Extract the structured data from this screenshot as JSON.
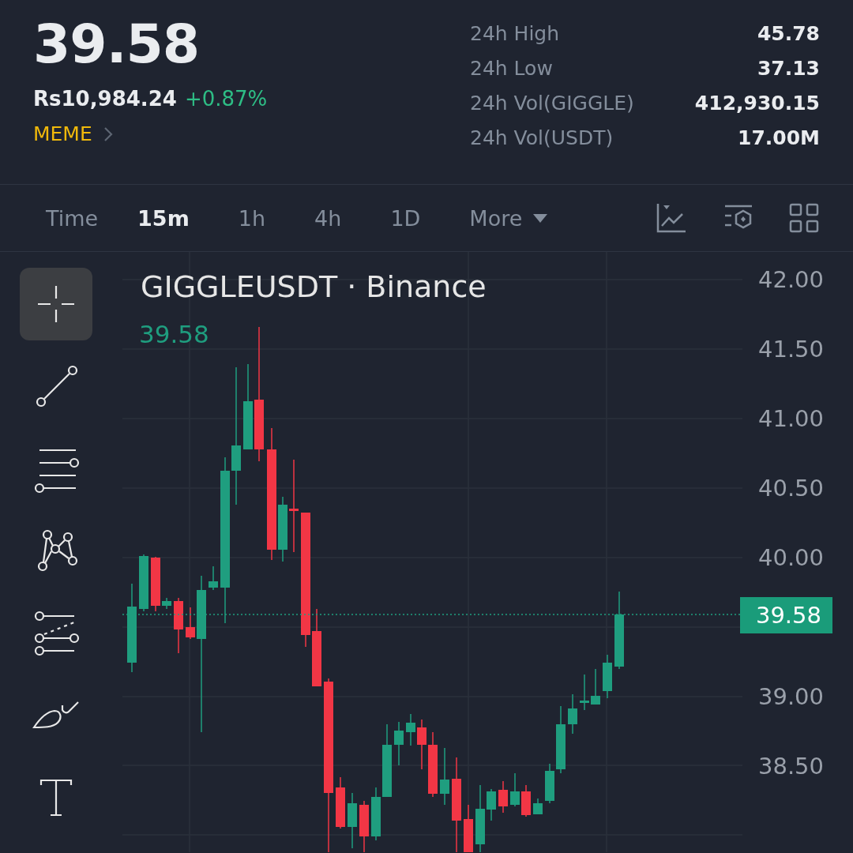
{
  "ticker": {
    "price": "39.58",
    "fiat_price": "Rs10,984.24",
    "change": "+0.87%",
    "tag": "MEME"
  },
  "stats": [
    {
      "label": "24h High",
      "value": "45.78"
    },
    {
      "label": "24h Low",
      "value": "37.13"
    },
    {
      "label": "24h Vol(GIGGLE)",
      "value": "412,930.15"
    },
    {
      "label": "24h Vol(USDT)",
      "value": "17.00M"
    }
  ],
  "interval_bar": {
    "label": "Time",
    "intervals": [
      {
        "label": "15m",
        "selected": true
      },
      {
        "label": "1h",
        "selected": false
      },
      {
        "label": "4h",
        "selected": false
      },
      {
        "label": "1D",
        "selected": false
      },
      {
        "label": "More",
        "selected": false
      }
    ]
  },
  "tools": [
    {
      "kind": "crosshair",
      "selected": true
    },
    {
      "kind": "trend-line",
      "selected": false
    },
    {
      "kind": "parallel-lines",
      "selected": false
    },
    {
      "kind": "pattern",
      "selected": false
    },
    {
      "kind": "fib",
      "selected": false
    },
    {
      "kind": "brush",
      "selected": false
    },
    {
      "kind": "text",
      "selected": false
    }
  ],
  "chart": {
    "symbol": "GIGGLEUSDT · Binance",
    "last_price": "39.58",
    "price_tag": "39.58",
    "price_axis": [
      "42.00",
      "41.50",
      "41.00",
      "40.50",
      "40.00",
      "39.00",
      "38.50"
    ]
  }
}
